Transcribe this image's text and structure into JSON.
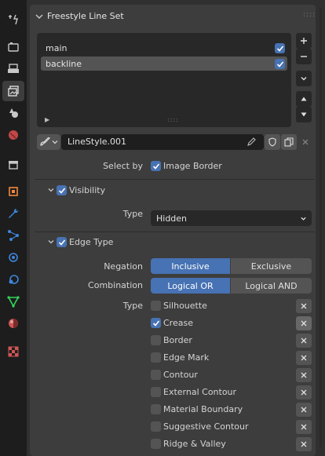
{
  "tabs": [
    {
      "name": "tool-tab-icon",
      "color": "#c8c8c8"
    },
    {
      "name": "render-tab-icon",
      "color": "#c8c8c8"
    },
    {
      "name": "output-tab-icon",
      "color": "#c8c8c8"
    },
    {
      "name": "view-layer-tab-icon",
      "color": "#c8c8c8",
      "active": true
    },
    {
      "name": "scene-tab-icon",
      "color": "#c8c8c8"
    },
    {
      "name": "world-tab-icon",
      "color": "#e05151"
    },
    {
      "name": "collection-tab-icon",
      "color": "#c8c8c8"
    },
    {
      "name": "object-tab-icon",
      "color": "#f0893f"
    },
    {
      "name": "modifier-tab-icon",
      "color": "#3e87dd"
    },
    {
      "name": "particles-tab-icon",
      "color": "#3e87dd"
    },
    {
      "name": "physics-tab-icon",
      "color": "#3e87dd"
    },
    {
      "name": "constraints-tab-icon",
      "color": "#3e87dd"
    },
    {
      "name": "data-tab-icon",
      "color": "#33d65a"
    },
    {
      "name": "material-tab-icon",
      "color": "#d05555"
    },
    {
      "name": "texture-tab-icon",
      "color": "#d05555"
    }
  ],
  "panel": {
    "title": "Freestyle Line Set",
    "lineset_list": [
      {
        "label": "main",
        "checked": true,
        "selected": false
      },
      {
        "label": "backline",
        "checked": true,
        "selected": true
      }
    ],
    "linestyle_name": "LineStyle.001",
    "select_by_label": "Select by",
    "image_border_label": "Image Border",
    "visibility": {
      "label": "Visibility",
      "type_label": "Type",
      "type_value": "Hidden"
    },
    "edge_type": {
      "label": "Edge Type",
      "negation_label": "Negation",
      "negation_options": [
        "Inclusive",
        "Exclusive"
      ],
      "negation_selected": "Inclusive",
      "combination_label": "Combination",
      "combination_options": [
        "Logical OR",
        "Logical AND"
      ],
      "combination_selected": "Logical OR",
      "type_label": "Type",
      "types": [
        {
          "label": "Silhouette",
          "checked": false
        },
        {
          "label": "Crease",
          "checked": true
        },
        {
          "label": "Border",
          "checked": false
        },
        {
          "label": "Edge Mark",
          "checked": false
        },
        {
          "label": "Contour",
          "checked": false
        },
        {
          "label": "External Contour",
          "checked": false
        },
        {
          "label": "Material Boundary",
          "checked": false
        },
        {
          "label": "Suggestive Contour",
          "checked": false
        },
        {
          "label": "Ridge & Valley",
          "checked": false
        }
      ]
    }
  },
  "colors": {
    "accent": "#4772b3",
    "panel": "#3d3d3d",
    "field": "#282828"
  }
}
